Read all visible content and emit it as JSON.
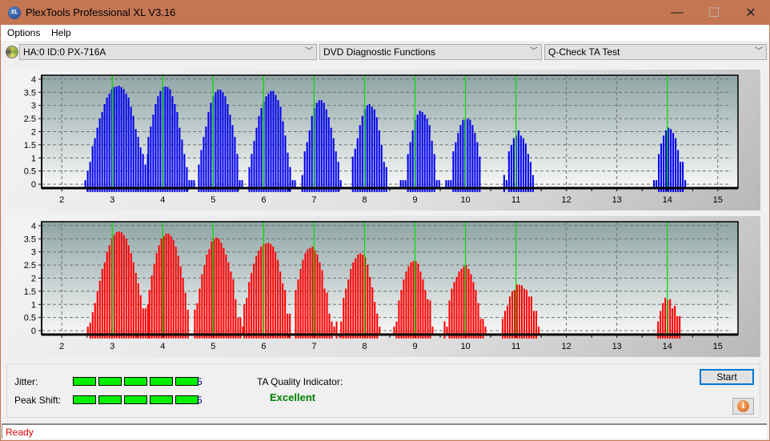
{
  "window": {
    "title": "PlexTools Professional XL V3.16",
    "app_icon_label": "XL",
    "minimize_glyph": "—",
    "maximize_glyph": "☐",
    "close_glyph": "✕"
  },
  "menu": {
    "items": [
      {
        "label": "Options"
      },
      {
        "label": "Help"
      }
    ]
  },
  "toolbar": {
    "drive_select": {
      "value": "HA:0 ID:0  PX-716A",
      "icon": "disc-drive-icon"
    },
    "function_select": {
      "value": "DVD Diagnostic Functions"
    },
    "test_select": {
      "value": "Q-Check TA Test"
    },
    "chevron_glyph": "﹀"
  },
  "chart_data": [
    {
      "type": "bar",
      "name": "jitter-histogram-lands",
      "title": "",
      "color": "#0000ee",
      "marker_color": "#00e000",
      "xlabel": "",
      "ylabel": "",
      "xlim": [
        1.6,
        15.4
      ],
      "ylim": [
        -0.15,
        4.15
      ],
      "x_ticks": [
        2,
        3,
        4,
        5,
        6,
        7,
        8,
        9,
        10,
        11,
        12,
        13,
        14,
        15
      ],
      "y_ticks": [
        0,
        0.5,
        1,
        1.5,
        2,
        2.5,
        3,
        3.5,
        4
      ],
      "y_tick_labels": [
        "0",
        "0.5",
        "1",
        "1.5",
        "2",
        "2.5",
        "3",
        "3.5",
        "4"
      ],
      "grid": true,
      "reference_lines_x": [
        3,
        4,
        5,
        6,
        7,
        8,
        9,
        10,
        11,
        14
      ],
      "bar_step": 0.0476,
      "series": [
        {
          "start": 2.45,
          "values": [
            0,
            0.5,
            0.85,
            1.45,
            1.75,
            2.15,
            2.5,
            2.75,
            3.05,
            3.3,
            3.45,
            3.62,
            3.7,
            3.72,
            3.75,
            3.7,
            3.62,
            3.45,
            3.3,
            2.95,
            2.6,
            2.1,
            1.8,
            1.4,
            1.15,
            0.75,
            1.15
          ]
        },
        {
          "start": 3.7,
          "values": [
            1.8,
            2.2,
            2.65,
            3.05,
            3.35,
            3.55,
            3.7,
            3.72,
            3.7,
            3.62,
            3.35,
            3.05,
            2.75,
            2.15,
            1.7,
            1.15,
            0.65,
            0,
            0,
            0
          ]
        },
        {
          "start": 4.7,
          "values": [
            0.75,
            1.3,
            1.8,
            2.2,
            2.75,
            3.1,
            3.35,
            3.5,
            3.6,
            3.6,
            3.5,
            3.35,
            3.05,
            2.65,
            2.25,
            1.8,
            1.15,
            0,
            0
          ]
        },
        {
          "start": 5.7,
          "values": [
            0.65,
            1.15,
            1.65,
            2.15,
            2.6,
            2.9,
            3.15,
            3.35,
            3.45,
            3.55,
            3.55,
            3.4,
            3.2,
            2.95,
            2.4,
            1.85,
            1.2,
            0.65,
            0,
            0
          ]
        },
        {
          "start": 6.75,
          "values": [
            0.35,
            1.25,
            1.6,
            2.05,
            2.6,
            2.9,
            3.1,
            3.2,
            3.2,
            3.1,
            2.85,
            2.55,
            2.15,
            1.75,
            1.25,
            0.85,
            0
          ]
        },
        {
          "start": 7.75,
          "values": [
            1.05,
            1.35,
            1.75,
            2.25,
            2.6,
            2.85,
            3.0,
            3.05,
            2.95,
            2.85,
            2.55,
            2.05,
            1.5,
            0.85,
            0.65
          ]
        },
        {
          "start": 8.7,
          "values": [
            0,
            0,
            0,
            1.15,
            1.6,
            2.05,
            2.45,
            2.65,
            2.8,
            2.75,
            2.65,
            2.5,
            2.25,
            1.65,
            1.15,
            0,
            0
          ]
        },
        {
          "start": 9.6,
          "values": [
            0,
            0,
            0,
            1.25,
            1.6,
            1.95,
            2.25,
            2.45,
            2.45,
            2.5,
            2.45,
            2.25,
            1.95,
            1.6,
            1.05
          ]
        },
        {
          "start": 10.75,
          "values": [
            0.35,
            0,
            1.25,
            1.5,
            1.75,
            1.85,
            2.05,
            1.85,
            1.75,
            1.55,
            1.15,
            0.85,
            0.35
          ]
        },
        {
          "start": 13.72,
          "values": [
            0,
            0,
            1.15,
            1.55,
            1.85,
            2.05,
            2.15,
            2.1,
            1.95,
            1.75,
            1.3,
            0.85,
            0.85,
            0
          ]
        }
      ]
    },
    {
      "type": "bar",
      "name": "jitter-histogram-pits",
      "title": "",
      "color": "#ff0000",
      "marker_color": "#00e000",
      "xlabel": "",
      "ylabel": "",
      "xlim": [
        1.6,
        15.4
      ],
      "ylim": [
        -0.15,
        4.15
      ],
      "x_ticks": [
        2,
        3,
        4,
        5,
        6,
        7,
        8,
        9,
        10,
        11,
        12,
        13,
        14,
        15
      ],
      "y_ticks": [
        0,
        0.5,
        1,
        1.5,
        2,
        2.5,
        3,
        3.5,
        4
      ],
      "y_tick_labels": [
        "0",
        "0.5",
        "1",
        "1.5",
        "2",
        "2.5",
        "3",
        "3.5",
        "4"
      ],
      "grid": true,
      "reference_lines_x": [
        3,
        4,
        5,
        6,
        7,
        8,
        9,
        10,
        11,
        14
      ],
      "bar_step": 0.0476,
      "series": [
        {
          "start": 2.5,
          "values": [
            0,
            0.3,
            0.7,
            1.05,
            1.5,
            1.9,
            2.35,
            2.6,
            3.0,
            3.25,
            3.5,
            3.65,
            3.75,
            3.78,
            3.75,
            3.65,
            3.5,
            3.25,
            2.95,
            2.6,
            2.2,
            1.8,
            1.35,
            0.85,
            0.85,
            1.0
          ]
        },
        {
          "start": 3.72,
          "values": [
            1.55,
            2.1,
            2.55,
            2.95,
            3.25,
            3.5,
            3.6,
            3.7,
            3.7,
            3.6,
            3.45,
            3.2,
            2.85,
            2.45,
            2.0,
            1.45,
            0.8
          ]
        },
        {
          "start": 4.62,
          "values": [
            0.8,
            1.05,
            1.6,
            2.15,
            2.5,
            2.9,
            3.1,
            3.4,
            3.5,
            3.55,
            3.5,
            3.35,
            3.15,
            2.9,
            2.6,
            2.25,
            1.95,
            1.2,
            0.5,
            0.5,
            0
          ]
        },
        {
          "start": 5.6,
          "values": [
            1.0,
            1.25,
            1.85,
            2.2,
            2.55,
            2.85,
            3.05,
            3.2,
            3.3,
            3.32,
            3.35,
            3.3,
            3.2,
            3.0,
            2.7,
            2.25,
            1.8,
            1.55,
            0.65,
            0.65
          ]
        },
        {
          "start": 6.62,
          "values": [
            1.55,
            1.95,
            2.35,
            2.7,
            2.95,
            3.1,
            3.15,
            3.2,
            3.05,
            2.9,
            2.6,
            2.3,
            1.6,
            1.45,
            0.65,
            0.35,
            0,
            0.35
          ]
        },
        {
          "start": 7.52,
          "values": [
            0.35,
            1.25,
            1.6,
            1.95,
            2.35,
            2.6,
            2.75,
            2.9,
            2.95,
            2.9,
            2.8,
            2.5,
            2.05,
            1.65,
            1.1,
            0.65,
            0
          ]
        },
        {
          "start": 8.57,
          "values": [
            0,
            0.35,
            1.15,
            1.55,
            1.95,
            2.25,
            2.45,
            2.6,
            2.65,
            2.65,
            2.55,
            2.25,
            1.95,
            1.55,
            1.2,
            1.15,
            0
          ]
        },
        {
          "start": 9.57,
          "values": [
            0.35,
            0,
            1.15,
            1.6,
            1.85,
            2.05,
            2.25,
            2.35,
            2.45,
            2.5,
            2.35,
            2.15,
            1.85,
            1.55,
            1.05,
            0.45,
            0.45,
            0
          ]
        },
        {
          "start": 10.72,
          "values": [
            0.45,
            0.75,
            0.95,
            1.3,
            1.5,
            1.55,
            1.75,
            1.75,
            1.72,
            1.6,
            1.55,
            1.3,
            1.3,
            0.75,
            0.75,
            0
          ]
        },
        {
          "start": 13.8,
          "values": [
            0.35,
            0.75,
            1.05,
            1.25,
            1.15,
            1.2,
            0.85,
            0.95,
            0.55,
            0.55
          ]
        }
      ]
    }
  ],
  "results": {
    "jitter": {
      "label": "Jitter:",
      "value": "5",
      "score": 5,
      "max": 5
    },
    "peak_shift": {
      "label": "Peak Shift:",
      "value": "5",
      "score": 5,
      "max": 5
    },
    "ta_quality": {
      "label": "TA Quality Indicator:",
      "value": "Excellent"
    }
  },
  "buttons": {
    "start_label": "Start",
    "info_glyph": "i"
  },
  "status": {
    "text": "Ready"
  }
}
